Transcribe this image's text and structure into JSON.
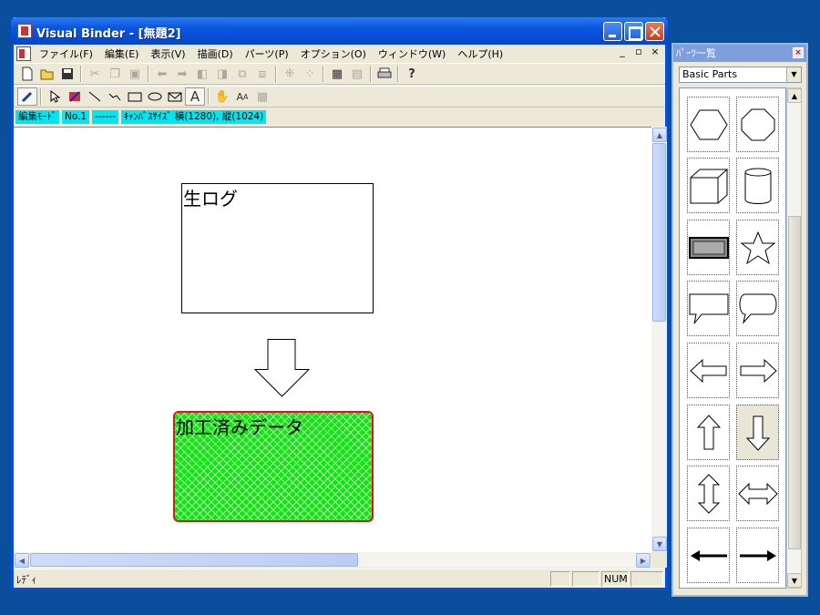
{
  "window": {
    "title": "Visual Binder - [無題2]"
  },
  "menu": {
    "items": [
      "ファイル(F)",
      "編集(E)",
      "表示(V)",
      "描画(D)",
      "パーツ(P)",
      "オプション(O)",
      "ウィンドウ(W)",
      "ヘルプ(H)"
    ]
  },
  "mdi_controls": [
    "_",
    "▫",
    "×"
  ],
  "toolbar1": {
    "icons": [
      "new-file-icon",
      "open-folder-icon",
      "save-icon",
      "cut-icon",
      "copy-icon",
      "paste-icon",
      "back-arrow-icon",
      "forward-arrow-icon",
      "align-left-icon",
      "align-right-icon",
      "bring-front-icon",
      "send-back-icon",
      "group-icon",
      "ungroup-icon",
      "properties-icon",
      "layers-icon",
      "print-icon",
      "help-icon"
    ]
  },
  "toolbar2": {
    "icons": [
      "pen-icon",
      "select-arrow-icon",
      "color-icon",
      "line-icon",
      "polyline-icon",
      "rectangle-icon",
      "ellipse-icon",
      "polygon-icon",
      "text-icon",
      "hand-icon",
      "font-size-icon",
      "grid-icon"
    ]
  },
  "modebar": {
    "chips": [
      "編集ﾓｰﾄﾞ",
      "No.1",
      "------",
      "ｷｬﾝﾊﾞｽｻｲｽﾞ 横(1280), 縦(1024)"
    ]
  },
  "canvas": {
    "shapes": [
      {
        "type": "rect",
        "text": "生ログ",
        "fill": "#ffffff",
        "stroke": "#000000"
      },
      {
        "type": "arrow-down",
        "fill": "#ffffff",
        "stroke": "#000000"
      },
      {
        "type": "rounded-rect",
        "text": "加工済みデータ",
        "fill": "#19e019",
        "stroke": "#e0141a"
      }
    ]
  },
  "statusbar": {
    "text": "ﾚﾃﾞｨ",
    "panels": [
      "",
      "",
      "NUM",
      ""
    ]
  },
  "palette": {
    "title": "ﾊﾟｰﾂ一覧",
    "close": "×",
    "category": "Basic Parts",
    "items": [
      "hexagon-part",
      "octagon-part",
      "cube-part",
      "cylinder-part",
      "button-part",
      "star-part",
      "speech-rect-part",
      "speech-round-part",
      "arrow-left-part",
      "arrow-right-part",
      "arrow-up-part",
      "arrow-down-part",
      "arrow-updown-part",
      "arrow-leftright-part",
      "line-arrow-left-part",
      "line-arrow-right-part"
    ],
    "selected_item": "arrow-down-part"
  },
  "colors": {
    "title_bar": "#0a54e0",
    "desktop": "#0a4f9c",
    "chip": "#00e6f0",
    "green_fill": "#19e019",
    "red_border": "#e0141a"
  }
}
